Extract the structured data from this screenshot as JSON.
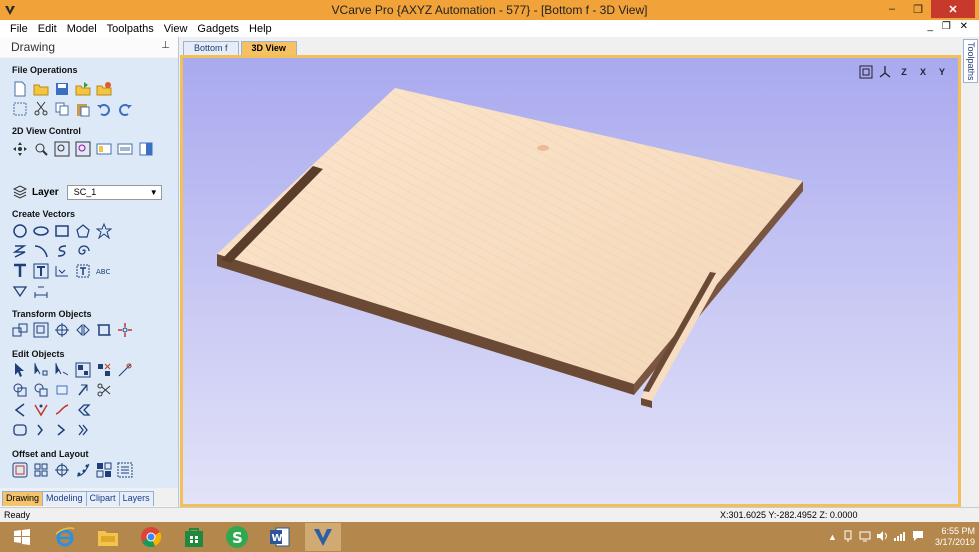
{
  "window": {
    "title": "VCarve Pro {AXYZ Automation - 577} - [Bottom f - 3D View]",
    "app_icon": "vcarve-logo-icon",
    "minimize": "–",
    "restore": "❐",
    "close": "✕"
  },
  "menu": {
    "items": [
      "File",
      "Edit",
      "Model",
      "Toolpaths",
      "View",
      "Gadgets",
      "Help"
    ],
    "right_controls": "_ ❐ ✕"
  },
  "left_panel": {
    "title": "Drawing",
    "pin": "⊥",
    "sections": {
      "file_operations": "File Operations",
      "view_control": "2D View Control",
      "create_vectors": "Create Vectors",
      "transform_objects": "Transform Objects",
      "edit_objects": "Edit Objects",
      "offset_layout": "Offset and Layout"
    },
    "layer_label": "Layer",
    "layer_value": "SC_1",
    "tabs": [
      "Drawing",
      "Modeling",
      "Clipart",
      "Layers"
    ]
  },
  "doc_tabs": [
    "Bottom f",
    "3D View"
  ],
  "right_tab": "Toolpaths",
  "view_tools": [
    "Z",
    "X",
    "Y"
  ],
  "status": {
    "ready": "Ready",
    "coords": "X:301.6025 Y:-282.4952 Z:  0.0000"
  },
  "taskbar": {
    "time": "6:55 PM",
    "date": "3/17/2019",
    "tray_up": "▲"
  },
  "colors": {
    "title_bar": "#f1a33a",
    "panel_bg": "#dde9f6",
    "viewport_frame": "#f3bf58",
    "board_top": "#f6dcc0",
    "board_edge": "#6b4a35",
    "taskbar": "#b4874c"
  }
}
